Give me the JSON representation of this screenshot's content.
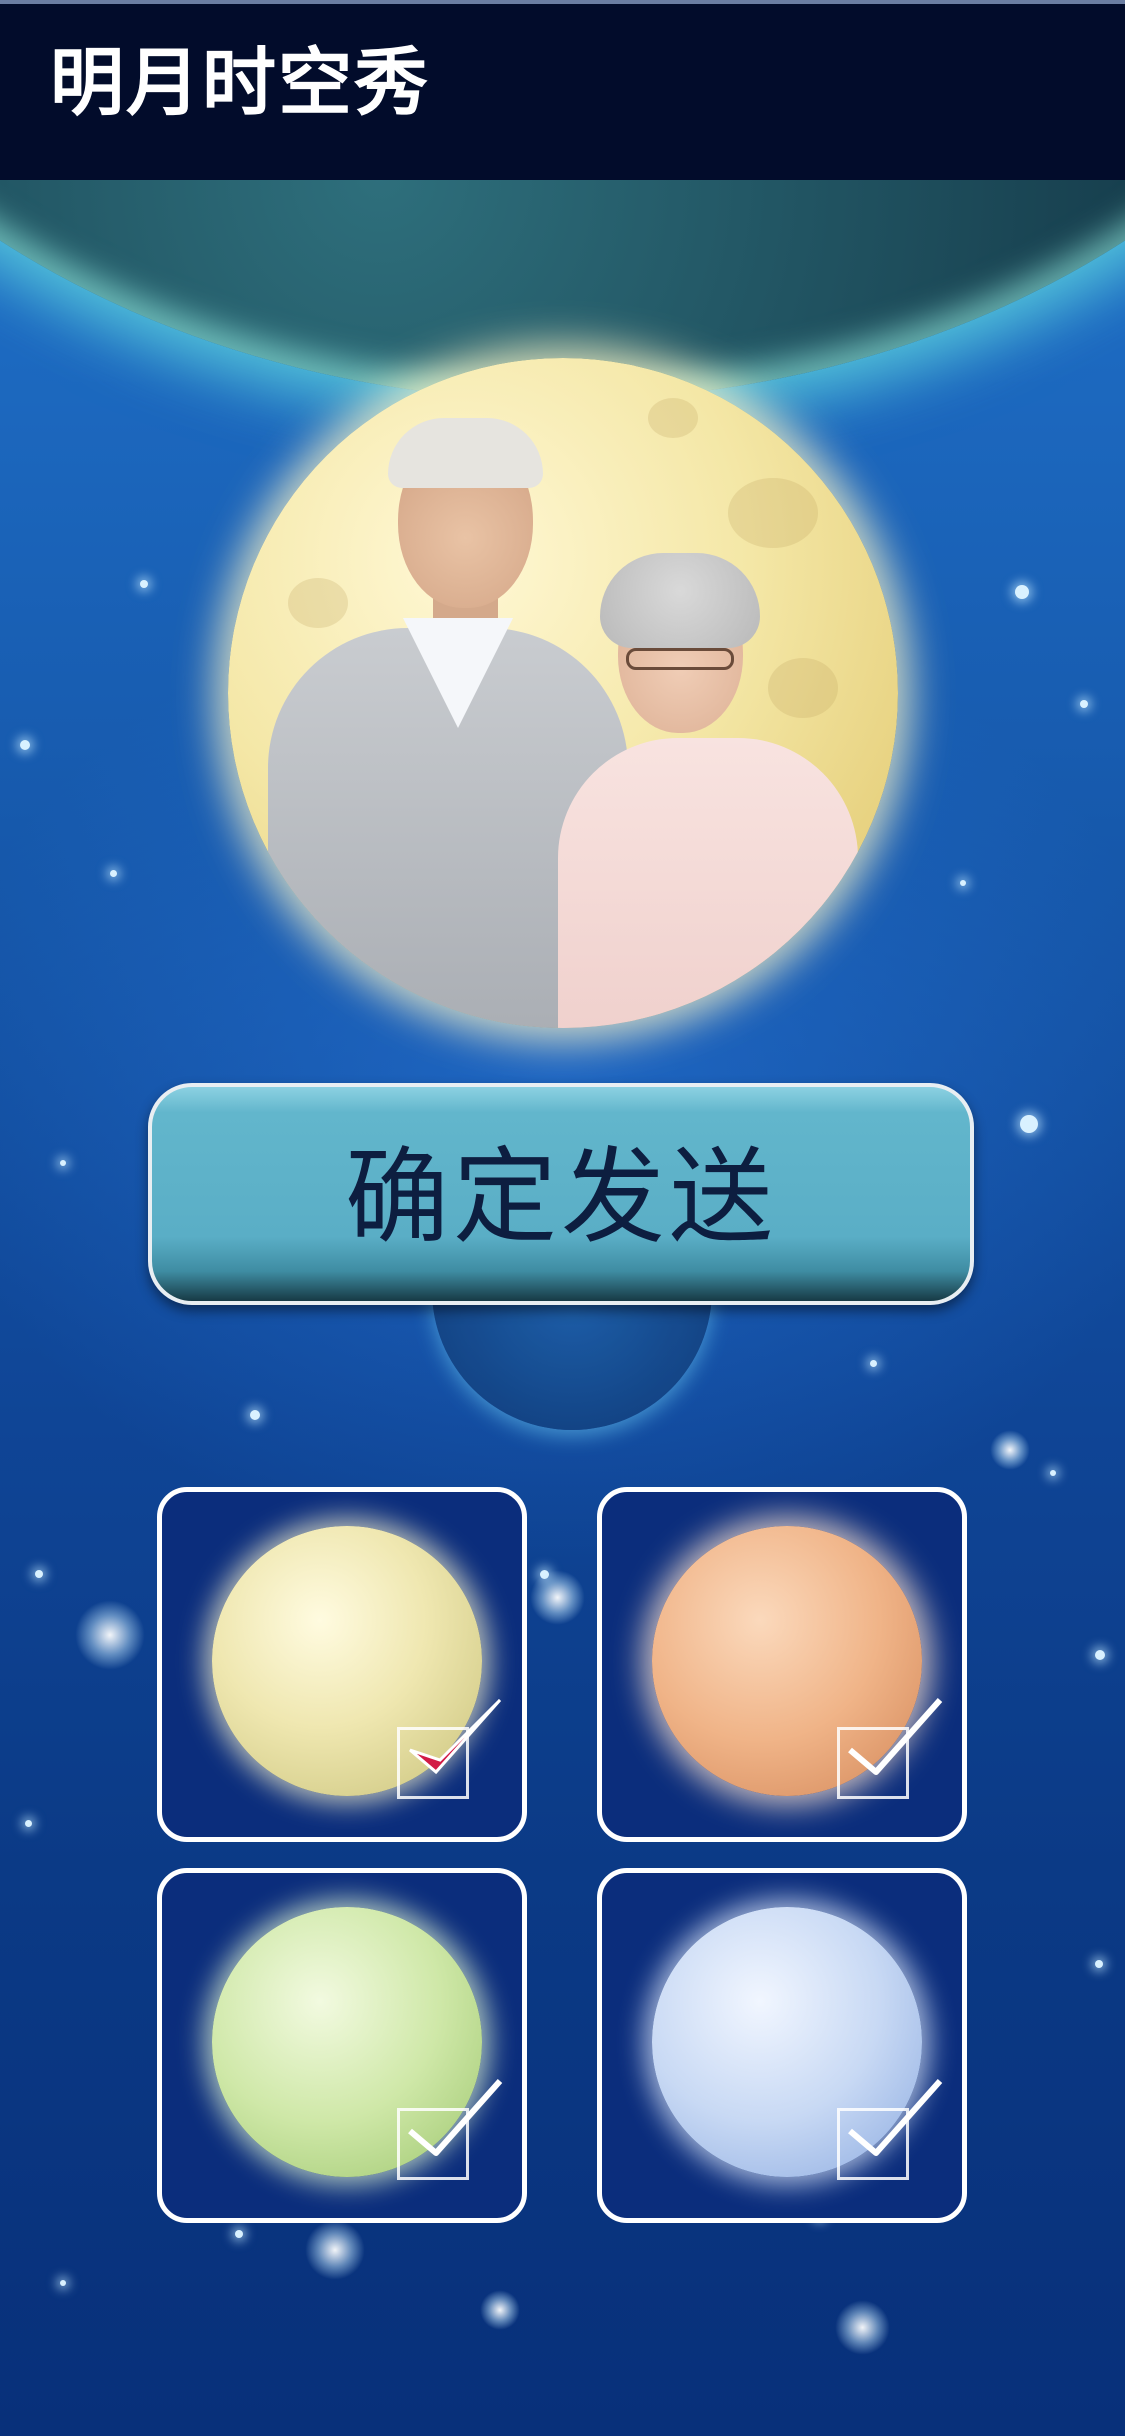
{
  "header": {
    "title": "明月时空秀"
  },
  "main": {
    "send_button_label": "确定发送"
  },
  "moon_options": [
    {
      "id": "yellow",
      "color": "#f1e9b3",
      "selected": true
    },
    {
      "id": "orange",
      "color": "#f0b488",
      "selected": false
    },
    {
      "id": "green",
      "color": "#cfe8a8",
      "selected": false
    },
    {
      "id": "blue",
      "color": "#c8d9f4",
      "selected": false
    }
  ],
  "colors": {
    "header_bg": "#020c2b",
    "button_bg": "#5aaec6",
    "button_text": "#0d1e40",
    "option_bg": "#0b2d7c",
    "check_selected": "#d21b45",
    "check_unselected": "#ffffff"
  },
  "icons": {
    "check_icon": "check-icon"
  }
}
